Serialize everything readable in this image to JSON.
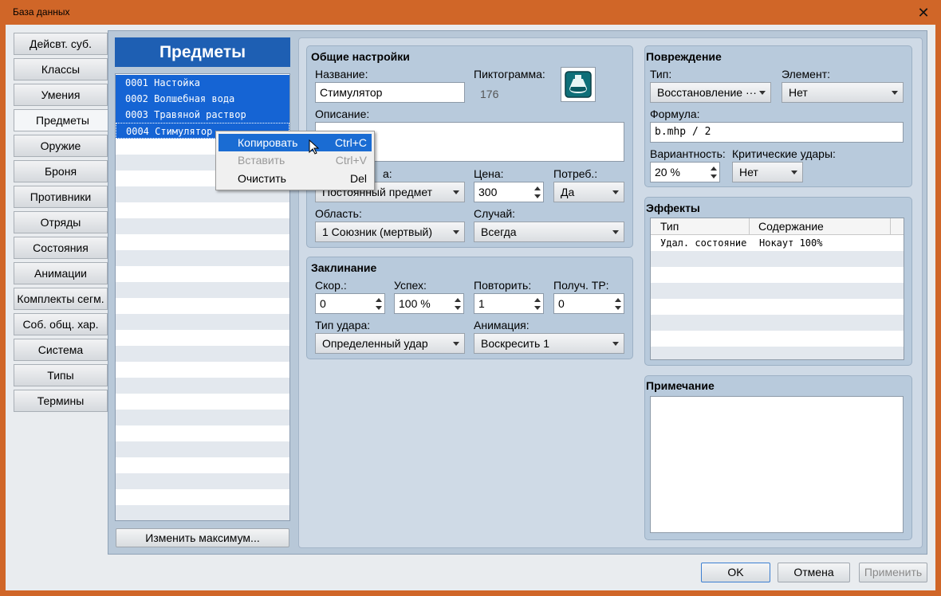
{
  "window": {
    "title": "База данных",
    "close_icon": "close-icon"
  },
  "tabs": [
    "Дейсвт. суб.",
    "Классы",
    "Умения",
    "Предметы",
    "Оружие",
    "Броня",
    "Противники",
    "Отряды",
    "Состояния",
    "Анимации",
    "Комплекты сегм.",
    "Соб. общ. хар.",
    "Система",
    "Типы",
    "Термины"
  ],
  "active_tab_index": 3,
  "list": {
    "header": "Предметы",
    "items": [
      "0001 Настойка",
      "0002 Волшебная вода",
      "0003 Травяной раствор",
      "0004 Стимулятор"
    ],
    "change_max_button": "Изменить максимум..."
  },
  "context_menu": {
    "items": [
      {
        "label": "Копировать",
        "shortcut": "Ctrl+C",
        "state": "highlighted"
      },
      {
        "label": "Вставить",
        "shortcut": "Ctrl+V",
        "state": "disabled"
      },
      {
        "label": "Очистить",
        "shortcut": "Del",
        "state": "normal"
      }
    ]
  },
  "general": {
    "title": "Общие настройки",
    "name_label": "Название:",
    "name_value": "Стимулятор",
    "icon_label": "Пиктограмма:",
    "icon_index": "176",
    "icon_name": "potion-icon",
    "description_label": "Описание:",
    "description_value": "",
    "item_type_label_partial": "а:",
    "item_type_value": "Постоянный предмет",
    "price_label": "Цена:",
    "price_value": "300",
    "consumable_label": "Потреб.:",
    "consumable_value": "Да",
    "scope_label": "Область:",
    "scope_value": "1 Союзник (мертвый)",
    "occasion_label": "Случай:",
    "occasion_value": "Всегда"
  },
  "invocation": {
    "title": "Заклинание",
    "speed_label": "Скор.:",
    "speed_value": "0",
    "success_label": "Успех:",
    "success_value": "100 %",
    "repeat_label": "Повторить:",
    "repeat_value": "1",
    "tp_label": "Получ. TP:",
    "tp_value": "0",
    "hit_type_label": "Тип удара:",
    "hit_type_value": "Определенный удар",
    "animation_label": "Анимация:",
    "animation_value": "Воскресить 1"
  },
  "damage": {
    "title": "Повреждение",
    "type_label": "Тип:",
    "type_value": "Восстановление ···",
    "element_label": "Элемент:",
    "element_value": "Нет",
    "formula_label": "Формула:",
    "formula_value": "b.mhp / 2",
    "variance_label": "Вариантность:",
    "variance_value": "20 %",
    "critical_label": "Критические удары:",
    "critical_value": "Нет"
  },
  "effects": {
    "title": "Эффекты",
    "columns": [
      "Тип",
      "Содержание"
    ],
    "rows": [
      {
        "type": "Удал. состояние",
        "content": "Нокаут 100%"
      }
    ]
  },
  "note": {
    "title": "Примечание",
    "value": ""
  },
  "footer": {
    "ok": "OK",
    "cancel": "Отмена",
    "apply": "Применить"
  }
}
